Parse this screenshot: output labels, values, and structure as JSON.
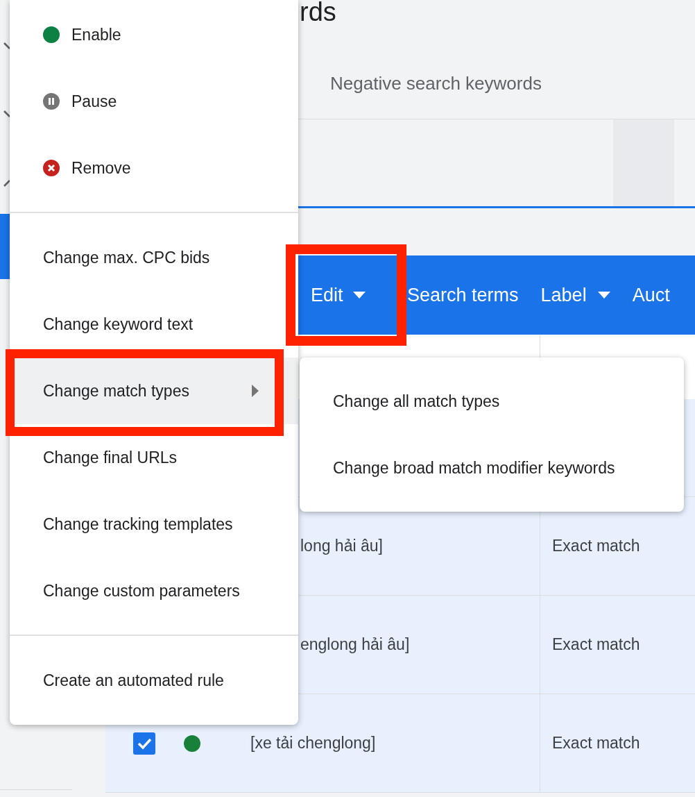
{
  "page_title": "rds",
  "tabs": [
    {
      "label": "Negative search keywords",
      "selected": false
    }
  ],
  "toolbar": [
    {
      "label": "Edit",
      "dropdown": true
    },
    {
      "label": "Search terms",
      "dropdown": false
    },
    {
      "label": "Label",
      "dropdown": true
    },
    {
      "label": "Auct",
      "dropdown": false
    }
  ],
  "table": {
    "rows": [
      {
        "keyword": "long hải âu]",
        "match_type": "Exact match"
      },
      {
        "keyword": "englong hải âu]",
        "match_type": "Exact match"
      },
      {
        "keyword": "[xe tải chenglong]",
        "match_type": "Exact match",
        "checked": true,
        "color": "#188038"
      }
    ]
  },
  "menu": {
    "sections": [
      [
        {
          "label": "Enable",
          "kind": "enabled"
        },
        {
          "label": "Pause",
          "kind": "paused"
        },
        {
          "label": "Remove",
          "kind": "removed"
        }
      ],
      [
        {
          "label": "Change max. CPC bids",
          "kind": "plain"
        },
        {
          "label": "Change keyword text",
          "kind": "plain"
        },
        {
          "label": "Change match types",
          "kind": "submenu",
          "highlighted": true
        },
        {
          "label": "Change final URLs",
          "kind": "plain"
        },
        {
          "label": "Change tracking templates",
          "kind": "plain"
        },
        {
          "label": "Change custom parameters",
          "kind": "plain"
        }
      ],
      [
        {
          "label": "Create an automated rule",
          "kind": "plain"
        }
      ]
    ]
  },
  "submenu": [
    {
      "label": "Change all match types"
    },
    {
      "label": "Change broad match modifier keywords"
    }
  ]
}
